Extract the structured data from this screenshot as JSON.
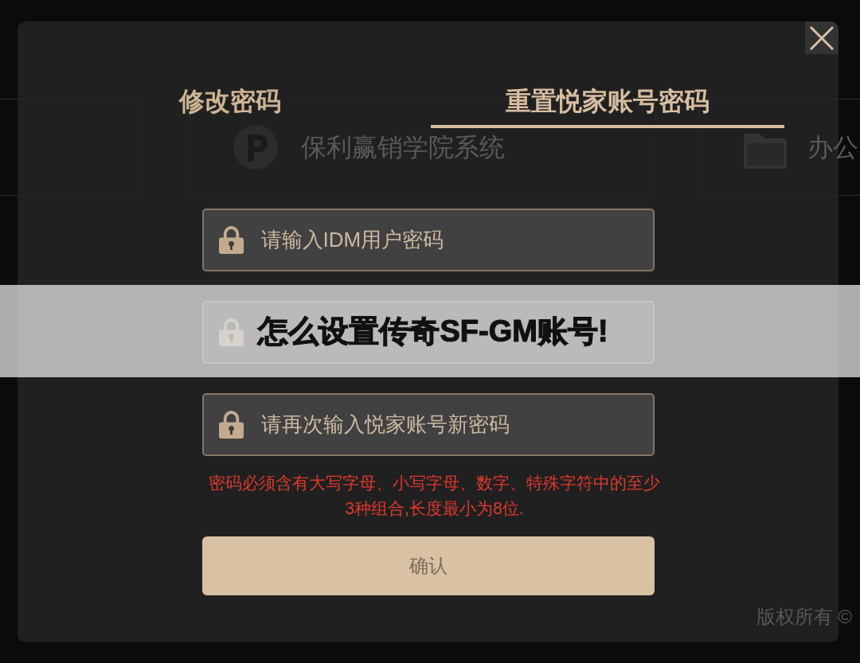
{
  "background": {
    "apps": [
      {
        "kind": "blank"
      },
      {
        "kind": "logo",
        "name": "保利赢销学院系统"
      },
      {
        "kind": "folder",
        "name": "办公"
      }
    ],
    "footer": "版权所有 ©"
  },
  "dialog": {
    "tabs": [
      {
        "label": "修改密码",
        "selected": false
      },
      {
        "label": "重置悦家账号密码",
        "selected": true
      }
    ],
    "fields": [
      {
        "kind": "password",
        "placeholder": "请输入IDM用户密码"
      },
      {
        "kind": "password"
      },
      {
        "kind": "password",
        "placeholder": "请再次输入悦家账号新密码"
      }
    ],
    "hint": "密码必须含有大写字母、小写字母、数字、特殊字符中的至少3种组合,长度最小为8位.",
    "confirm_button": "确认"
  },
  "banner": {
    "title": "怎么设置传奇SF-GM账号!"
  }
}
